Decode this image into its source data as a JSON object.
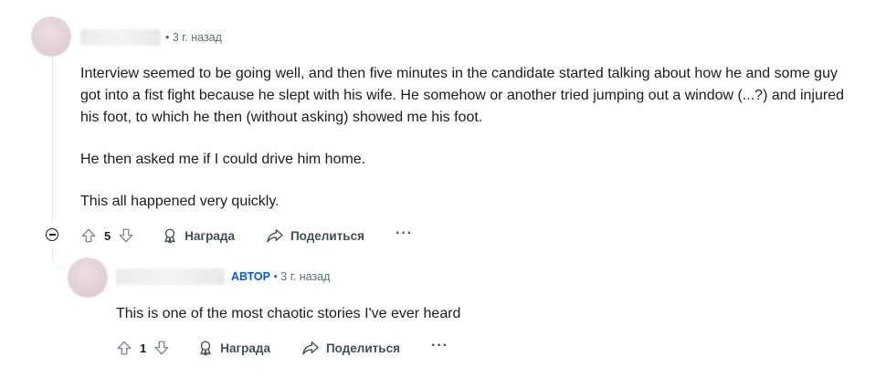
{
  "comment": {
    "time": "3 г. назад",
    "paragraphs": [
      "Interview seemed to be going well, and then five minutes in the candidate started talking about how he and some guy got into a fist fight because he slept with his wife. He somehow or another tried jumping out a window (...?) and injured his foot, to which he then (without asking) showed me his foot.",
      "He then asked me if I could drive him home.",
      "This all happened very quickly."
    ],
    "votes": "5",
    "award_label": "Награда",
    "share_label": "Поделиться",
    "more_label": "···"
  },
  "reply": {
    "author_tag": "АВТОР",
    "time": "3 г. назад",
    "text": "This is one of the most chaotic stories I've ever heard",
    "votes": "1",
    "award_label": "Награда",
    "share_label": "Поделиться",
    "more_label": "···"
  },
  "colors": {
    "meta": "#576f76",
    "author_tag": "#0a5bc4",
    "thread_line": "#e5ebee",
    "text": "#1c1c1c"
  },
  "icons": [
    "upvote-icon",
    "downvote-icon",
    "award-icon",
    "share-icon",
    "collapse-icon"
  ]
}
